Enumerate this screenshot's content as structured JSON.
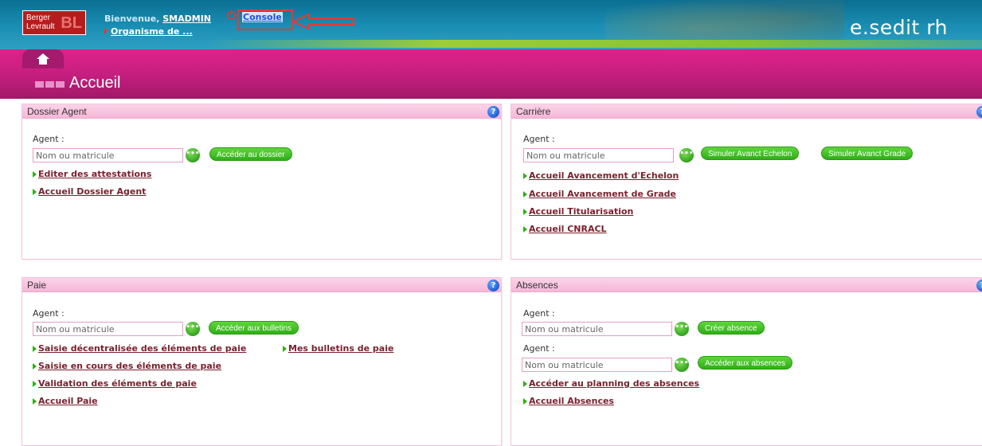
{
  "header": {
    "logo": {
      "line1": "Berger",
      "line2": "Levrault",
      "mark": "BL"
    },
    "welcome": "Bienvenue,",
    "username": "SMADMIN",
    "console": "Console",
    "organisation": "Organisme de ...",
    "brand": "e.sedit rh",
    "icons": {
      "power": "power-icon",
      "home": "home-icon"
    }
  },
  "page": {
    "title": "Accueil"
  },
  "panels": {
    "dossier": {
      "title": "Dossier Agent",
      "agent_label": "Agent :",
      "placeholder": "Nom ou matricule",
      "button": "Accéder au dossier",
      "links": [
        "Editer des attestations",
        "Accueil Dossier Agent"
      ]
    },
    "carriere": {
      "title": "Carrière",
      "agent_label": "Agent :",
      "placeholder": "Nom ou matricule",
      "button1": "Simuler Avanct Echelon",
      "button2": "Simuler Avanct Grade",
      "links": [
        "Accueil Avancement d'Echelon",
        "Accueil Avancement de Grade",
        "Accueil Titularisation",
        "Accueil CNRACL"
      ]
    },
    "paie": {
      "title": "Paie",
      "agent_label": "Agent :",
      "placeholder": "Nom ou matricule",
      "button": "Accéder aux bulletins",
      "links": [
        "Saisie décentralisée des éléments de paie",
        "Mes bulletins de paie",
        "Saisie en cours des éléments de paie",
        "Validation des éléments de paie",
        "Accueil Paie"
      ]
    },
    "absences": {
      "title": "Absences",
      "agent_label": "Agent :",
      "placeholder": "Nom ou matricule",
      "button1": "Créer absence",
      "agent_label2": "Agent :",
      "placeholder2": "Nom ou matricule",
      "button2": "Accéder aux absences",
      "links": [
        "Accéder au planning des absences",
        "Accueil Absences"
      ]
    }
  },
  "colors": {
    "header_blue": "#1b8fb4",
    "pink": "#c61f80",
    "green": "#2fae16",
    "link": "#7a1f2c"
  }
}
